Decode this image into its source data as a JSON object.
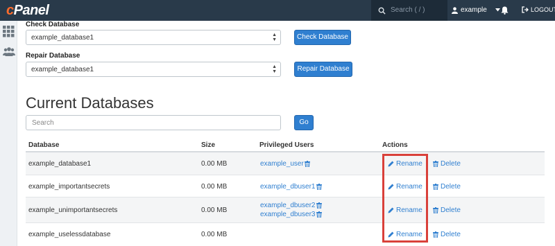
{
  "header": {
    "logo_c": "c",
    "logo_rest": "Panel",
    "search_placeholder": "Search ( / )",
    "username": "example",
    "logout_label": "LOGOUT"
  },
  "check": {
    "label": "Check Database",
    "selected": "example_database1",
    "button": "Check Database"
  },
  "repair": {
    "label": "Repair Database",
    "selected": "example_database1",
    "button": "Repair Database"
  },
  "current": {
    "title": "Current Databases",
    "search_placeholder": "Search",
    "go_button": "Go"
  },
  "table": {
    "headers": [
      "Database",
      "Size",
      "Privileged Users",
      "Actions"
    ],
    "rows": [
      {
        "name": "example_database1",
        "size": "0.00 MB",
        "users": [
          "example_user"
        ],
        "rename": "Rename",
        "delete": "Delete"
      },
      {
        "name": "example_importantsecrets",
        "size": "0.00 MB",
        "users": [
          "example_dbuser1"
        ],
        "rename": "Rename",
        "delete": "Delete"
      },
      {
        "name": "example_unimportantsecrets",
        "size": "0.00 MB",
        "users": [
          "example_dbuser2",
          "example_dbuser3"
        ],
        "rename": "Rename",
        "delete": "Delete"
      },
      {
        "name": "example_uselessdatabase",
        "size": "0.00 MB",
        "users": [],
        "rename": "Rename",
        "delete": "Delete"
      }
    ]
  },
  "colors": {
    "topbar": "#293a4a",
    "accent": "#2f7fd0",
    "highlight": "#d9403a"
  }
}
